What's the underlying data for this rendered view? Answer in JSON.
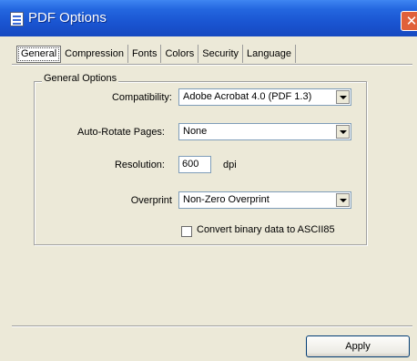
{
  "window": {
    "title": "PDF Options",
    "close_glyph": "✕"
  },
  "tabs": [
    {
      "label": "General",
      "selected": true
    },
    {
      "label": "Compression"
    },
    {
      "label": "Fonts"
    },
    {
      "label": "Colors"
    },
    {
      "label": "Security"
    },
    {
      "label": "Language"
    }
  ],
  "general_options": {
    "title": "General Options",
    "compatibility": {
      "label": "Compatibility:",
      "value": "Adobe Acrobat 4.0 (PDF 1.3)"
    },
    "auto_rotate": {
      "label": "Auto-Rotate Pages:",
      "value": "None"
    },
    "resolution": {
      "label": "Resolution:",
      "value": "600",
      "unit": "dpi"
    },
    "overprint": {
      "label": "Overprint",
      "value": "Non-Zero Overprint"
    },
    "ascii85": {
      "label": "Convert binary data to ASCII85",
      "checked": false
    }
  },
  "buttons": {
    "apply": "Apply"
  },
  "icons": {
    "title_icon": "document-icon",
    "close_icon": "close-icon",
    "dropdown_icon": "chevron-down-icon"
  }
}
